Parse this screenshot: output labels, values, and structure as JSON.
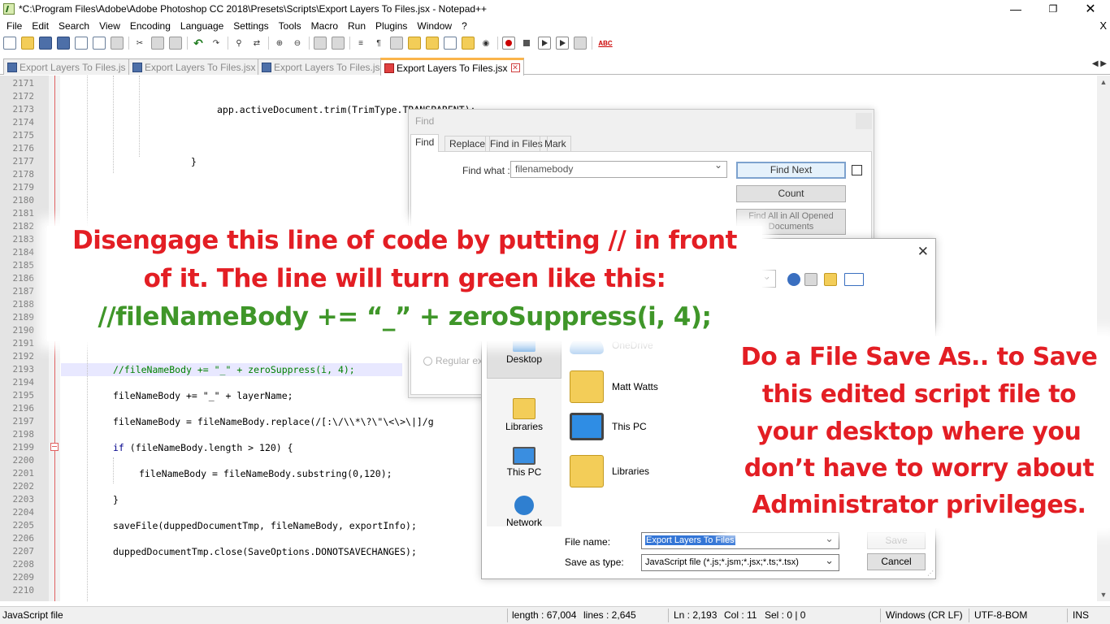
{
  "window": {
    "title": "*C:\\Program Files\\Adobe\\Adobe Photoshop CC 2018\\Presets\\Scripts\\Export Layers To Files.jsx - Notepad++",
    "minimize": "—",
    "maximize": "❐",
    "close": "✕"
  },
  "menu": {
    "items": [
      "File",
      "Edit",
      "Search",
      "View",
      "Encoding",
      "Language",
      "Settings",
      "Tools",
      "Macro",
      "Run",
      "Plugins",
      "Window",
      "?"
    ],
    "doc_close": "X"
  },
  "toolbar": {
    "icons": [
      "new-file-icon",
      "open-file-icon",
      "save-icon",
      "save-all-icon",
      "close-icon",
      "close-all-icon",
      "print-icon",
      "cut-icon",
      "copy-icon",
      "paste-icon",
      "undo-icon",
      "redo-icon",
      "find-icon",
      "replace-icon",
      "zoom-in-icon",
      "zoom-out-icon",
      "sync-v-icon",
      "sync-h-icon",
      "wrap-icon",
      "all-chars-icon",
      "indent-guide-icon",
      "udl-icon",
      "doc-map-icon",
      "func-list-icon",
      "folder-workspace-icon",
      "monitor-icon",
      "record-macro-icon",
      "stop-macro-icon",
      "play-macro-icon",
      "run-macro-icon",
      "save-macro-icon",
      "spellcheck-icon"
    ],
    "spellcheck_label": "ABC"
  },
  "tabs": [
    {
      "label": "Export Layers To Files.js",
      "active": false
    },
    {
      "label": "Export Layers To Files.jsx",
      "active": false
    },
    {
      "label": "Export Layers To Files.js",
      "active": false
    },
    {
      "label": "Export Layers To Files.jsx",
      "active": true
    }
  ],
  "tab_close_glyph": "✕",
  "tab_arrows": "◀ ▶",
  "editor": {
    "line_numbers": [
      "2171",
      "2172",
      "2173",
      "2174",
      "2175",
      "2176",
      "2177",
      "2178",
      "2179",
      "2180",
      "2181",
      "2182",
      "2183",
      "2184",
      "2185",
      "2186",
      "2187",
      "2188",
      "2189",
      "2190",
      "2191",
      "2192",
      "2193",
      "2194",
      "2195",
      "2196",
      "2197",
      "2198",
      "2199",
      "2200",
      "2201",
      "2202",
      "2203",
      "2204",
      "2205",
      "2206",
      "2207",
      "2208",
      "2209",
      "2210"
    ],
    "code": {
      "l2173": "app.activeDocument.trim(TrimType.TRANSPARENT);",
      "l2177": "}",
      "l2193": "//fileNameBody += \"_\" + zeroSuppress(i, 4);",
      "l2195": "fileNameBody += \"_\" + layerName;",
      "l2197": "fileNameBody = fileNameBody.replace(/[:\\/\\\\*\\?\\\"\\<\\>\\|]/g",
      "l2199_kw": "if",
      "l2199_rest": " (fileNameBody.length > 120) {",
      "l2201": "fileNameBody = fileNameBody.substring(0,120);",
      "l2203": "}",
      "l2205": "saveFile(duppedDocumentTmp, fileNameBody, exportInfo);",
      "l2207": "duppedDocumentTmp.close(SaveOptions.DONOTSAVECHANGES);"
    }
  },
  "statusbar": {
    "file_type": "JavaScript file",
    "length": "length : 67,004",
    "lines": "lines : 2,645",
    "ln": "Ln : 2,193",
    "col": "Col : 11",
    "sel": "Sel : 0 | 0",
    "eol": "Windows (CR LF)",
    "encoding": "UTF-8-BOM",
    "mode": "INS"
  },
  "find_dialog": {
    "title": "Find",
    "tabs": [
      "Find",
      "Replace",
      "Find in Files",
      "Mark"
    ],
    "find_what_label": "Find what :",
    "find_what_value": "filenamebody",
    "find_next": "Find Next",
    "count": "Count",
    "find_all_opened": "Find All in All Opened Documents",
    "regular_exp": "Regular exp"
  },
  "save_dialog": {
    "close": "✕",
    "places": [
      "Desktop",
      "Libraries",
      "This PC",
      "Network"
    ],
    "items": [
      "OneDrive",
      "Matt Watts",
      "This PC",
      "Libraries"
    ],
    "file_name_label": "File name:",
    "file_name_value": "Export Layers To Files",
    "save_as_type_label": "Save as type:",
    "save_as_type_value": "JavaScript file (*.js;*.jsm;*.jsx;*.ts;*.tsx)",
    "save_button": "Save",
    "cancel_button": "Cancel"
  },
  "annotations": {
    "left": {
      "line1": "Disengage this line of code by putting // in front",
      "line2": "of it. The line will turn green like this:",
      "line3": "//fileNameBody += “_” + zeroSuppress(i, 4);",
      "color_red": "#e31e24",
      "color_green": "#3f9629"
    },
    "right": {
      "line1": "Do a File Save As.. to Save",
      "line2": "this edited script file  to",
      "line3": "your desktop where you",
      "line4": "don’t have to worry about",
      "line5": "Administrator privileges.",
      "color": "#e31e24"
    }
  }
}
